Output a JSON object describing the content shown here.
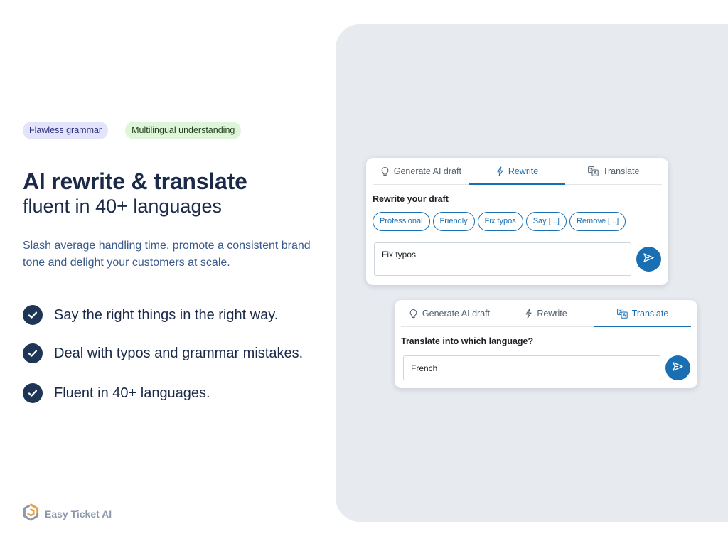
{
  "badges": {
    "grammar": "Flawless grammar",
    "multilingual": "Multilingual understanding"
  },
  "hero": {
    "title": "AI rewrite & translate",
    "subtitle": "fluent in 40+ languages",
    "description": "Slash average handling time, promote a consistent brand tone and delight your customers at scale."
  },
  "features": [
    "Say the right things in the right way.",
    "Deal with typos and grammar mistakes.",
    "Fluent in 40+ languages."
  ],
  "brand": {
    "name": "Easy Ticket AI"
  },
  "rewrite_card": {
    "tabs": [
      {
        "label": "Generate AI draft",
        "icon": "lightbulb-icon"
      },
      {
        "label": "Rewrite",
        "icon": "lightning-icon"
      },
      {
        "label": "Translate",
        "icon": "translate-icon"
      }
    ],
    "active_tab": "Rewrite",
    "heading": "Rewrite your draft",
    "chips": [
      "Professional",
      "Friendly",
      "Fix typos",
      "Say [...]",
      "Remove [...]"
    ],
    "input_value": "Fix typos"
  },
  "translate_card": {
    "tabs": [
      {
        "label": "Generate AI draft",
        "icon": "lightbulb-icon"
      },
      {
        "label": "Rewrite",
        "icon": "lightning-icon"
      },
      {
        "label": "Translate",
        "icon": "translate-icon"
      }
    ],
    "active_tab": "Translate",
    "heading": "Translate into which language?",
    "input_value": "French"
  },
  "colors": {
    "accent": "#1a6fb3",
    "navy": "#1c2a4a",
    "panel": "#e7eaef",
    "badge_purple": "#e3e4fb",
    "badge_green": "#dff5d9"
  }
}
